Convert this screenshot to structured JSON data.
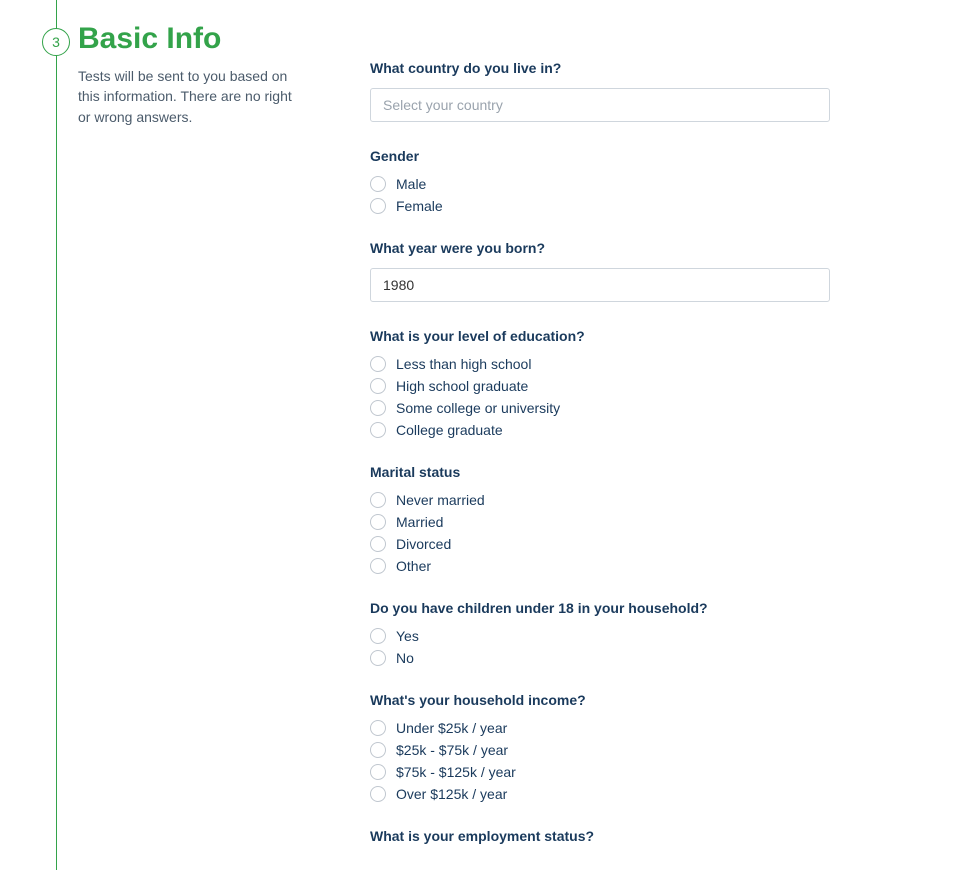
{
  "step": {
    "number": "3",
    "title": "Basic Info",
    "description": "Tests will be sent to you based on this information. There are no right or wrong answers."
  },
  "questions": {
    "country": {
      "label": "What country do you live in?",
      "placeholder": "Select your country",
      "value": ""
    },
    "gender": {
      "label": "Gender",
      "options": [
        "Male",
        "Female"
      ]
    },
    "birth_year": {
      "label": "What year were you born?",
      "value": "1980"
    },
    "education": {
      "label": "What is your level of education?",
      "options": [
        "Less than high school",
        "High school graduate",
        "Some college or university",
        "College graduate"
      ]
    },
    "marital": {
      "label": "Marital status",
      "options": [
        "Never married",
        "Married",
        "Divorced",
        "Other"
      ]
    },
    "children": {
      "label": "Do you have children under 18 in your household?",
      "options": [
        "Yes",
        "No"
      ]
    },
    "income": {
      "label": "What's your household income?",
      "options": [
        "Under $25k / year",
        "$25k - $75k / year",
        "$75k - $125k / year",
        "Over $125k / year"
      ]
    },
    "employment": {
      "label": "What is your employment status?"
    }
  }
}
